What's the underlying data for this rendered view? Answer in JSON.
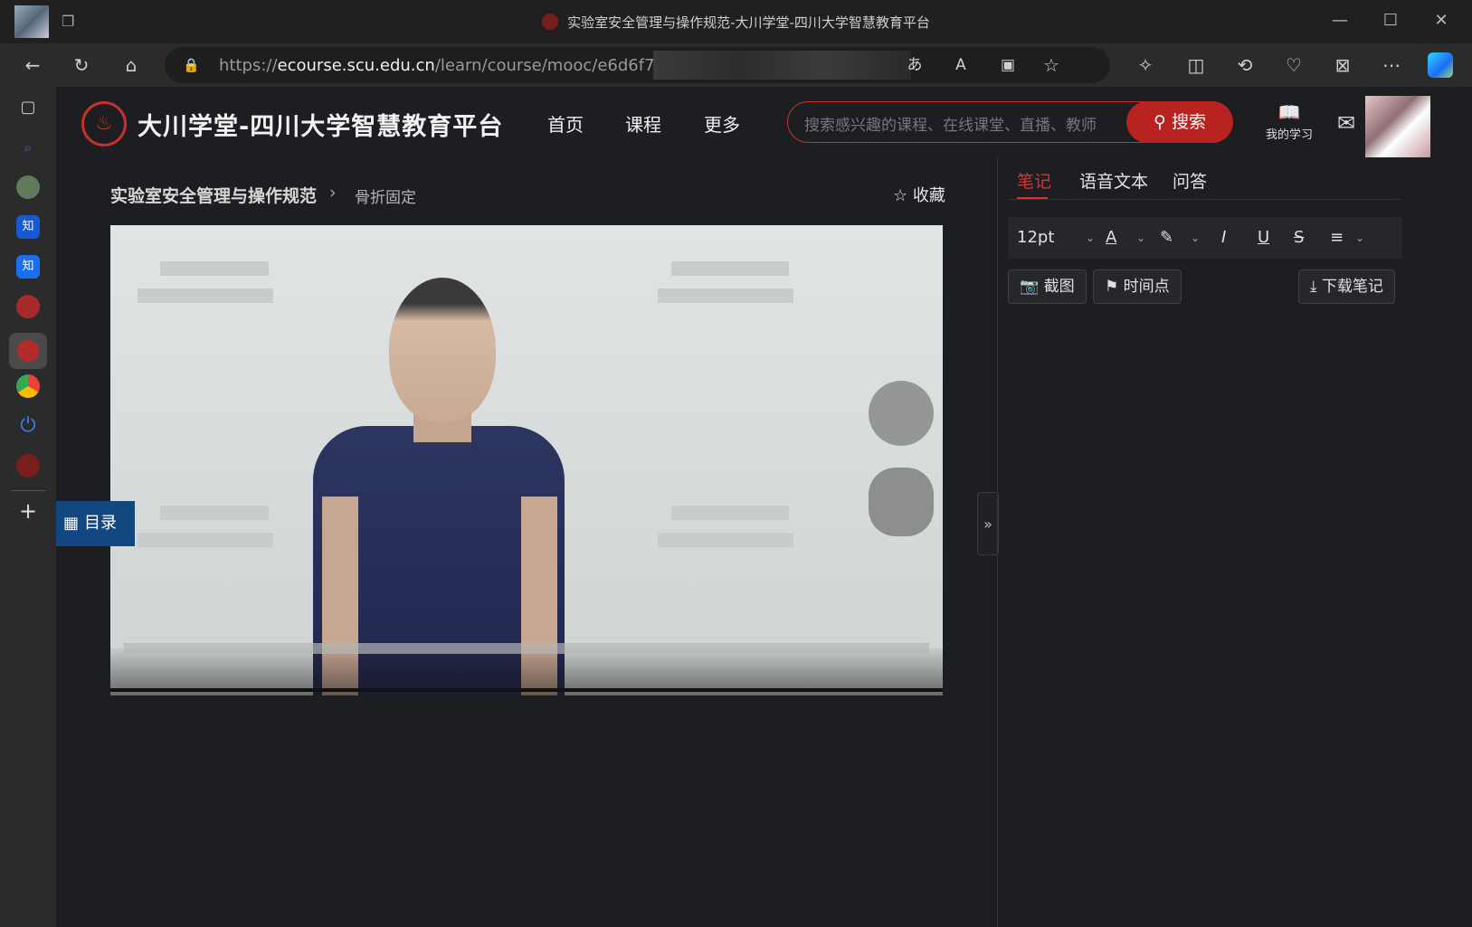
{
  "window": {
    "title": "实验室安全管理与操作规范-大川学堂-四川大学智慧教育平台"
  },
  "browser": {
    "url_prefix": "https://",
    "url_host": "ecourse.scu.edu.cn",
    "url_path": "/learn/course/mooc/e6d6f70eef094f",
    "url_tail": "."
  },
  "site": {
    "name": "大川学堂-四川大学智慧教育平台",
    "nav": [
      "首页",
      "课程",
      "更多"
    ],
    "search_placeholder": "搜索感兴趣的课程、在线课堂、直播、教师",
    "search_button": "搜索",
    "my_learning": "我的学习"
  },
  "breadcrumb": {
    "course": "实验室安全管理与操作规范",
    "lesson": "骨折固定"
  },
  "favorite_label": "收藏",
  "toc_label": "目录",
  "notes_panel": {
    "tabs": [
      "笔记",
      "语音文本",
      "问答"
    ],
    "active_tab": "笔记",
    "font_size": "12pt",
    "buttons": {
      "screenshot": "截图",
      "timepoint": "时间点",
      "download": "下载笔记"
    }
  },
  "colors": {
    "brand_red": "#c7302c",
    "toc_blue": "#13477f",
    "active_tab": "#d9342f"
  }
}
